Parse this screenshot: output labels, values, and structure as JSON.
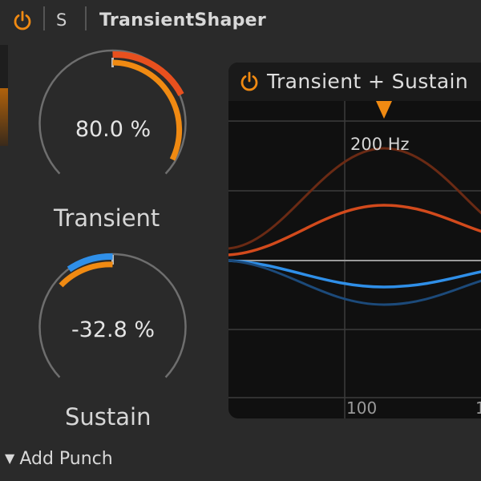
{
  "titlebar": {
    "power_icon": "power-icon",
    "solo_label": "S",
    "device_name": "TransientShaper"
  },
  "knobs": {
    "transient": {
      "value": "80.0 %",
      "label": "Transient",
      "fraction": 0.9
    },
    "sustain": {
      "value": "-32.8 %",
      "label": "Sustain",
      "fraction": -0.33
    }
  },
  "graph": {
    "title": "Transient + Sustain",
    "frequency_label": "200 Hz",
    "ticks": [
      "100",
      "1"
    ]
  },
  "footer": {
    "add_punch_label": "Add Punch",
    "disclosure_icon": "triangle-down-icon"
  },
  "colors": {
    "accent_orange": "#f08a12",
    "transient_red": "#e8501e",
    "sustain_blue": "#2f8fe8",
    "panel_bg": "#101010",
    "bg": "#2a2a2a"
  }
}
